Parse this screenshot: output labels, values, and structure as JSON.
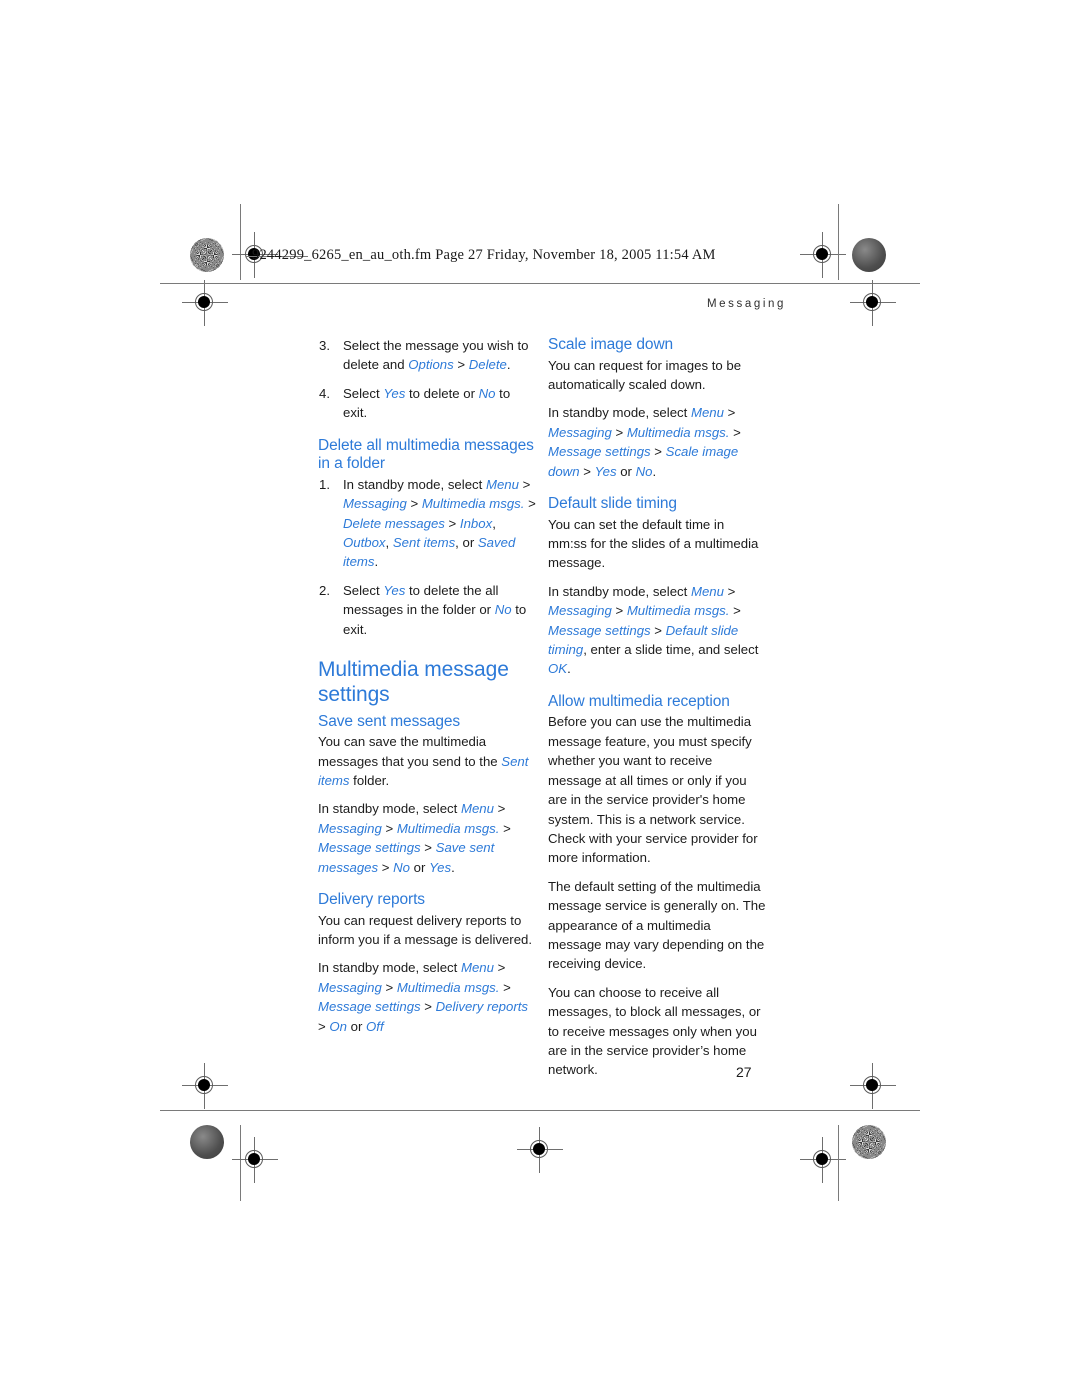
{
  "print_header": {
    "file_info": "9244299_6265_en_au_oth.fm  Page 27  Friday, November 18, 2005  11:54 AM"
  },
  "running_head": "Messaging",
  "folio": "27",
  "colors": {
    "heading_blue": "#2d7ad8",
    "body_black": "#1c1c1c",
    "page_background": "#ffffff"
  },
  "left_column": {
    "continued_steps": [
      {
        "num": "3.",
        "parts": [
          {
            "t": "Select the message you wish to delete and ",
            "style": "plain"
          },
          {
            "t": "Options",
            "style": "ui"
          },
          {
            "t": " > ",
            "style": "sep"
          },
          {
            "t": "Delete",
            "style": "ui"
          },
          {
            "t": ".",
            "style": "plain"
          }
        ]
      },
      {
        "num": "4.",
        "parts": [
          {
            "t": "Select ",
            "style": "plain"
          },
          {
            "t": "Yes",
            "style": "ui"
          },
          {
            "t": " to delete or ",
            "style": "plain"
          },
          {
            "t": "No",
            "style": "ui"
          },
          {
            "t": " to exit.",
            "style": "plain"
          }
        ]
      }
    ],
    "sub_heading_delete_all": "Delete all multimedia messages in a folder",
    "delete_all_steps": [
      {
        "num": "1.",
        "parts": [
          {
            "t": "In standby mode, select ",
            "style": "plain"
          },
          {
            "t": "Menu",
            "style": "ui"
          },
          {
            "t": " > ",
            "style": "sep"
          },
          {
            "t": "Messaging",
            "style": "ui"
          },
          {
            "t": " > ",
            "style": "sep"
          },
          {
            "t": "Multimedia msgs.",
            "style": "ui"
          },
          {
            "t": " > ",
            "style": "sep"
          },
          {
            "t": "Delete messages",
            "style": "ui"
          },
          {
            "t": " > ",
            "style": "sep"
          },
          {
            "t": "Inbox",
            "style": "ui"
          },
          {
            "t": ", ",
            "style": "sep"
          },
          {
            "t": "Outbox",
            "style": "ui"
          },
          {
            "t": ", ",
            "style": "sep"
          },
          {
            "t": "Sent items",
            "style": "ui"
          },
          {
            "t": ", or ",
            "style": "sep"
          },
          {
            "t": "Saved items",
            "style": "ui"
          },
          {
            "t": ".",
            "style": "plain"
          }
        ]
      },
      {
        "num": "2.",
        "parts": [
          {
            "t": "Select ",
            "style": "plain"
          },
          {
            "t": "Yes",
            "style": "ui"
          },
          {
            "t": " to delete the all messages in the folder or ",
            "style": "plain"
          },
          {
            "t": "No",
            "style": "ui"
          },
          {
            "t": " to exit.",
            "style": "plain"
          }
        ]
      }
    ],
    "section_heading": "Multimedia message settings",
    "save_sent": {
      "heading": "Save sent messages",
      "paragraph_1": [
        {
          "t": "You can save the multimedia messages that you send to the ",
          "style": "plain"
        },
        {
          "t": "Sent items",
          "style": "ui"
        },
        {
          "t": " folder.",
          "style": "plain"
        }
      ],
      "paragraph_2": [
        {
          "t": "In standby mode, select ",
          "style": "plain"
        },
        {
          "t": "Menu",
          "style": "ui"
        },
        {
          "t": " > ",
          "style": "sep"
        },
        {
          "t": "Messaging",
          "style": "ui"
        },
        {
          "t": " > ",
          "style": "sep"
        },
        {
          "t": "Multimedia msgs.",
          "style": "ui"
        },
        {
          "t": " > ",
          "style": "sep"
        },
        {
          "t": "Message settings",
          "style": "ui"
        },
        {
          "t": " > ",
          "style": "sep"
        },
        {
          "t": "Save sent messages",
          "style": "ui"
        },
        {
          "t": " > ",
          "style": "sep"
        },
        {
          "t": "No",
          "style": "ui"
        },
        {
          "t": " or ",
          "style": "sep"
        },
        {
          "t": "Yes",
          "style": "ui"
        },
        {
          "t": ".",
          "style": "plain"
        }
      ]
    },
    "delivery_reports": {
      "heading": "Delivery reports",
      "paragraph_1": [
        {
          "t": "You can request delivery reports to inform you if a message is delivered.",
          "style": "plain"
        }
      ],
      "paragraph_2": [
        {
          "t": "In standby mode, select ",
          "style": "plain"
        },
        {
          "t": "Menu",
          "style": "ui"
        },
        {
          "t": " > ",
          "style": "sep"
        },
        {
          "t": "Messaging",
          "style": "ui"
        },
        {
          "t": " > ",
          "style": "sep"
        },
        {
          "t": "Multimedia msgs.",
          "style": "ui"
        },
        {
          "t": " > ",
          "style": "sep"
        },
        {
          "t": "Message settings",
          "style": "ui"
        },
        {
          "t": " > ",
          "style": "sep"
        },
        {
          "t": "Delivery reports",
          "style": "ui"
        },
        {
          "t": " > ",
          "style": "sep"
        },
        {
          "t": "On",
          "style": "ui"
        },
        {
          "t": " or ",
          "style": "sep"
        },
        {
          "t": "Off",
          "style": "ui"
        }
      ]
    }
  },
  "right_column": {
    "scale_image_down": {
      "heading": "Scale image down",
      "paragraph_1": [
        {
          "t": "You can request for images to be automatically scaled down.",
          "style": "plain"
        }
      ],
      "paragraph_2": [
        {
          "t": "In standby mode, select ",
          "style": "plain"
        },
        {
          "t": "Menu",
          "style": "ui"
        },
        {
          "t": " > ",
          "style": "sep"
        },
        {
          "t": "Messaging",
          "style": "ui"
        },
        {
          "t": " > ",
          "style": "sep"
        },
        {
          "t": "Multimedia msgs.",
          "style": "ui"
        },
        {
          "t": " > ",
          "style": "sep"
        },
        {
          "t": "Message settings",
          "style": "ui"
        },
        {
          "t": " > ",
          "style": "sep"
        },
        {
          "t": "Scale image down",
          "style": "ui"
        },
        {
          "t": " > ",
          "style": "sep"
        },
        {
          "t": "Yes",
          "style": "ui"
        },
        {
          "t": " or ",
          "style": "sep"
        },
        {
          "t": "No",
          "style": "ui"
        },
        {
          "t": ".",
          "style": "plain"
        }
      ]
    },
    "default_slide_timing": {
      "heading": "Default slide timing",
      "paragraph_1": [
        {
          "t": "You can set the default time in mm:ss for the slides of a multimedia message.",
          "style": "plain"
        }
      ],
      "paragraph_2": [
        {
          "t": "In standby mode, select ",
          "style": "plain"
        },
        {
          "t": "Menu",
          "style": "ui"
        },
        {
          "t": " > ",
          "style": "sep"
        },
        {
          "t": "Messaging",
          "style": "ui"
        },
        {
          "t": " > ",
          "style": "sep"
        },
        {
          "t": "Multimedia msgs.",
          "style": "ui"
        },
        {
          "t": " > ",
          "style": "sep"
        },
        {
          "t": "Message settings",
          "style": "ui"
        },
        {
          "t": " > ",
          "style": "sep"
        },
        {
          "t": "Default slide timing",
          "style": "ui"
        },
        {
          "t": ", enter a slide time, and select ",
          "style": "sep"
        },
        {
          "t": "OK",
          "style": "ui"
        },
        {
          "t": ".",
          "style": "plain"
        }
      ]
    },
    "allow_multimedia_reception": {
      "heading": "Allow multimedia reception",
      "paragraph_1": [
        {
          "t": "Before you can use the multimedia message feature, you must specify whether you want to receive message at all times or only if you are in the service provider's home system. This is a network service. Check with your service provider for more information.",
          "style": "plain"
        }
      ],
      "paragraph_2": [
        {
          "t": "The default setting of the multimedia message service is generally on. The appearance of a multimedia message may vary depending on the receiving device.",
          "style": "plain"
        }
      ],
      "paragraph_3": [
        {
          "t": "You can choose to receive all messages, to block all messages, or to receive messages only when you are in the service provider’s home network.",
          "style": "plain"
        }
      ]
    }
  }
}
